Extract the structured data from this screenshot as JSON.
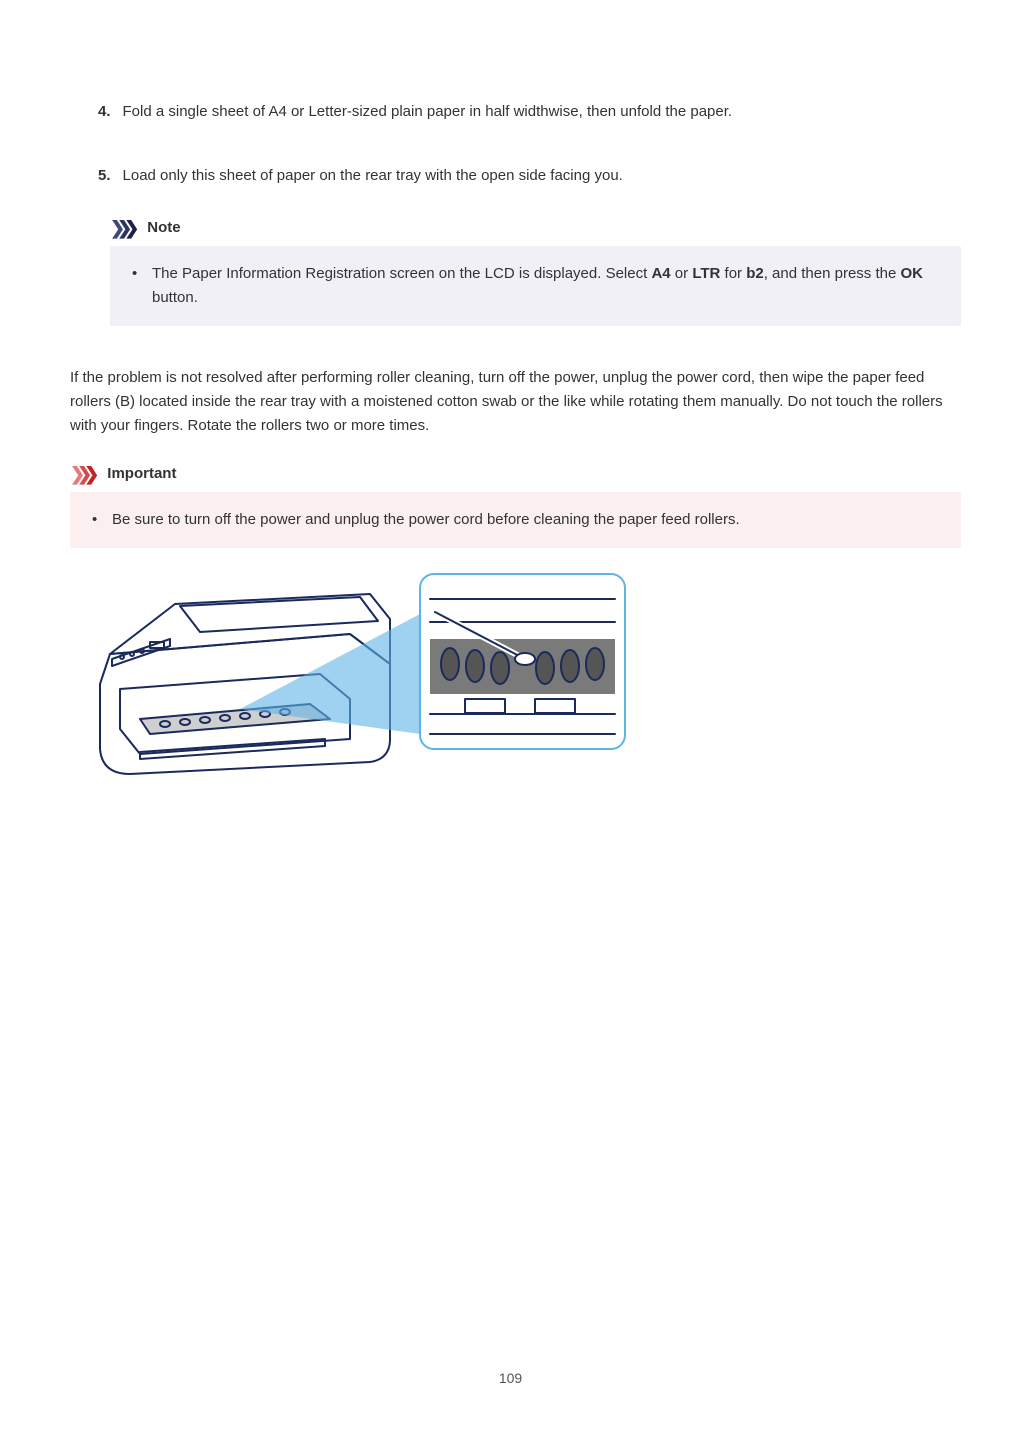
{
  "steps": {
    "step4_num": "4.",
    "step4_text": "Fold a single sheet of A4 or Letter-sized plain paper in half widthwise, then unfold the paper.",
    "step5_num": "5.",
    "step5_text": "Load only this sheet of paper on the rear tray with the open side facing you.",
    "step5_note_label": "Note",
    "step5_note_bullet": "•",
    "step5_note_text": "The Paper Information Registration screen on the LCD is displayed. Select A4 or LTR for b2, and then press the OK button.",
    "step5_emph_1": "A4",
    "step5_emph_2": "LTR",
    "step5_emph_3": "b2",
    "step5_emph_4": "OK"
  },
  "instruction": {
    "main": "If the problem is not resolved after performing roller cleaning, turn off the power, unplug the power cord, then wipe the paper feed rollers (B) located inside the rear tray with a moistened cotton swab or the like while rotating them manually. Do not touch the rollers with your fingers. Rotate the rollers two or more times.",
    "important_label": "Important",
    "important_bullet": "•",
    "important_text": "Be sure to turn off the power and unplug the power cord before cleaning the paper feed rollers."
  },
  "illustration_alt": "Printer diagram showing paper feed rollers being cleaned with a cotton swab",
  "page_number": "109"
}
